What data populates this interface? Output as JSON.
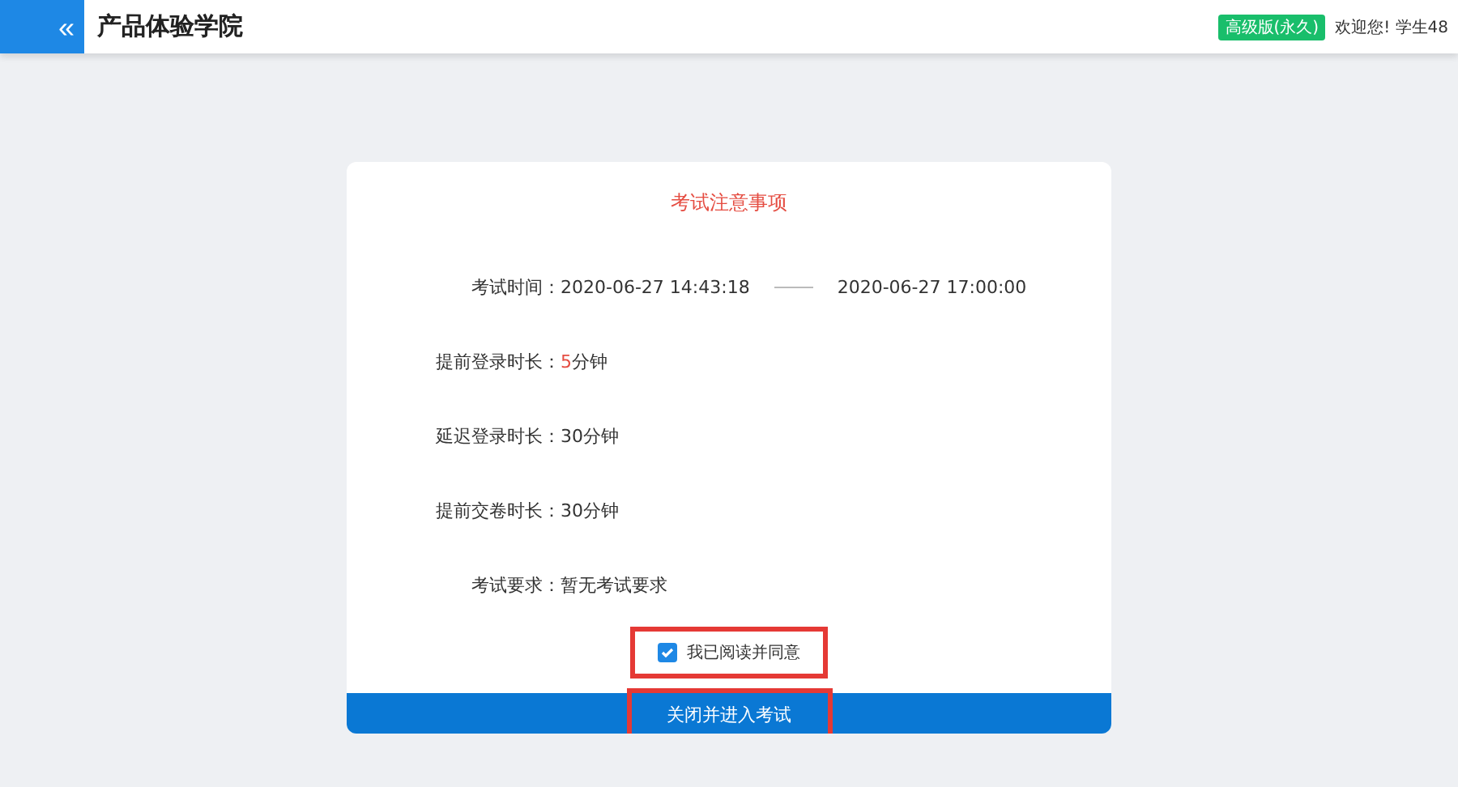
{
  "header": {
    "title": "产品体验学院",
    "collapse_icon": "«",
    "badge": "高级版(永久)",
    "greeting": "欢迎您! 学生48"
  },
  "notice": {
    "title": "考试注意事项",
    "rows": [
      {
        "kind": "range",
        "label": "考试时间：",
        "start": "2020-06-27 14:43:18",
        "end": "2020-06-27 17:00:00"
      },
      {
        "kind": "duration",
        "label": "提前登录时长：",
        "number": "5",
        "unit": "分钟",
        "highlight": true
      },
      {
        "kind": "duration",
        "label": "延迟登录时长：",
        "number": "30",
        "unit": "分钟",
        "highlight": false
      },
      {
        "kind": "duration",
        "label": "提前交卷时长：",
        "number": "30",
        "unit": "分钟",
        "highlight": false
      },
      {
        "kind": "text",
        "label": "考试要求：",
        "value": "暂无考试要求"
      }
    ],
    "agree": {
      "label": "我已阅读并同意",
      "checked": true,
      "highlighted": true
    },
    "button": {
      "label": "关闭并进入考试",
      "highlighted": true
    }
  }
}
